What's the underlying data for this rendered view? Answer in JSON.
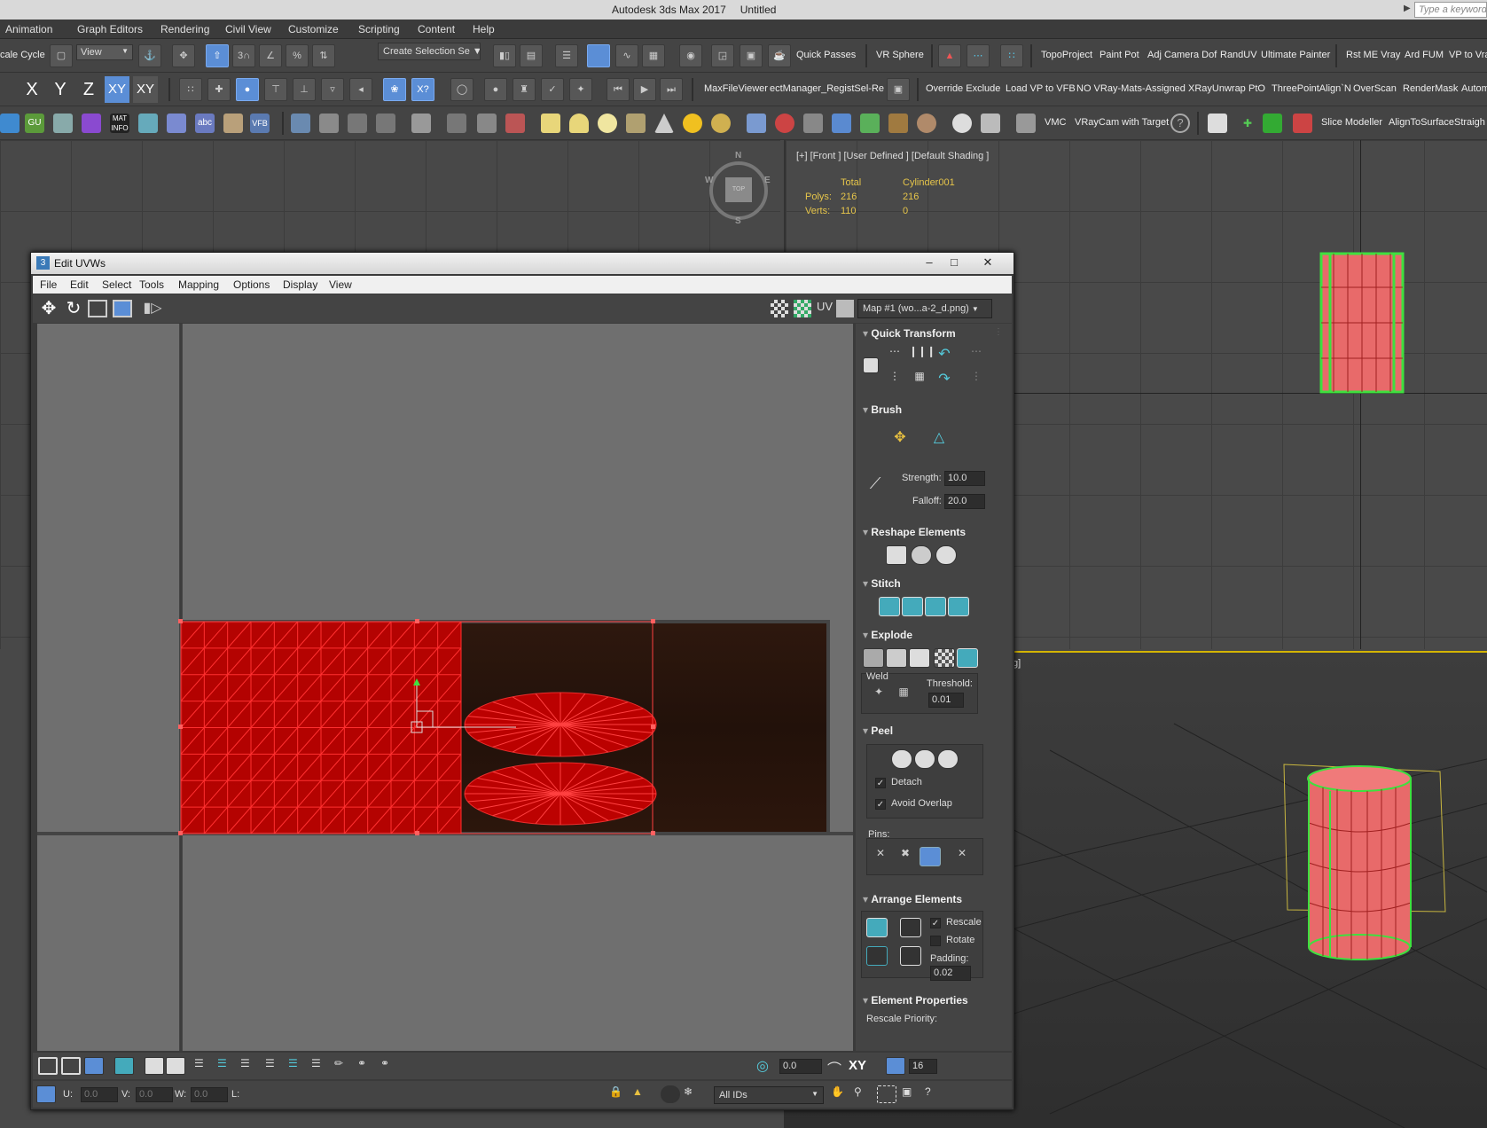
{
  "app": {
    "title": "Autodesk 3ds Max 2017",
    "document": "Untitled",
    "search_placeholder": "Type a keyword"
  },
  "menu": [
    "Animation",
    "Graph Editors",
    "Rendering",
    "Civil View",
    "Customize",
    "Scripting",
    "Content",
    "Help"
  ],
  "toolbar1": {
    "scale_cycle": "cale Cycle",
    "view_dropdown": "View",
    "selection_set": "Create Selection Se",
    "labels": [
      "Quick Passes",
      "VR Sphere",
      "TopoProject",
      "Paint Pot",
      "Adj Camera Dof",
      "RandUV",
      "Ultimate Painter",
      "Rst ME Vray",
      "Ard FUM",
      "VP to Vra"
    ]
  },
  "toolbar2": {
    "axes": [
      "X",
      "Y",
      "Z",
      "XY",
      "XY"
    ],
    "labels": [
      "MaxFileViewer",
      "ectManager_RegistSel-Re",
      "Override Exclude",
      "Load VP to VFB",
      "NO VRay-Mats-Assigned",
      "XRayUnwrap",
      "PtO",
      "ThreePointAlign`N",
      "OverScan",
      "RenderMask",
      "Autom"
    ]
  },
  "toolbar3": {
    "icon_texts": [
      "GU",
      "MAT INFO",
      "abc",
      "VFB"
    ],
    "labels": [
      "VMC",
      "VRayCam with Target",
      "Slice Modeller",
      "AlignToSurface",
      "Straigh"
    ]
  },
  "viewport": {
    "label": "[+] [Front ] [User Defined ] [Default Shading ]",
    "stats_header_total": "Total",
    "stats_header_object": "Cylinder001",
    "polys_label": "Polys:",
    "polys_total": "216",
    "polys_object": "216",
    "verts_label": "Verts:",
    "verts_total": "110",
    "verts_object": "0",
    "viewcube": {
      "n": "N",
      "s": "S",
      "e": "E",
      "w": "W",
      "face": "TOP"
    },
    "partial_label": "g]"
  },
  "uvw_window": {
    "title": "Edit UVWs",
    "menu": [
      "File",
      "Edit",
      "Select",
      "Tools",
      "Mapping",
      "Options",
      "Display",
      "View"
    ],
    "uv_label": "UV",
    "map_dropdown": "Map #1 (wo...a-2_d.png)",
    "rollouts": {
      "quick_transform": "Quick Transform",
      "brush": "Brush",
      "strength_label": "Strength:",
      "strength_value": "10.0",
      "falloff_label": "Falloff:",
      "falloff_value": "20.0",
      "reshape": "Reshape Elements",
      "stitch": "Stitch",
      "explode": "Explode",
      "weld_label": "Weld",
      "threshold_label": "Threshold:",
      "threshold_value": "0.01",
      "peel": "Peel",
      "detach_label": "Detach",
      "detach_checked": true,
      "avoid_overlap_label": "Avoid Overlap",
      "avoid_overlap_checked": true,
      "pins_label": "Pins:",
      "arrange": "Arrange Elements",
      "rescale_label": "Rescale",
      "rescale_checked": true,
      "rotate_label": "Rotate",
      "rotate_checked": false,
      "padding_label": "Padding:",
      "padding_value": "0.02",
      "element_props": "Element Properties",
      "rescale_priority_label": "Rescale Priority:"
    },
    "bottom": {
      "rotation_value": "0.0",
      "xy_label": "XY",
      "grid_value": "16",
      "u_label": "U:",
      "u_value": "0.0",
      "v_label": "V:",
      "v_value": "0.0",
      "w_label": "W:",
      "w_value": "0.0",
      "l_label": "L:",
      "ids_dropdown": "All IDs"
    }
  },
  "colors": {
    "accent": "#5b8ed6",
    "uv_red": "#d40000",
    "wood_dark": "#2a150d",
    "selection_green": "#3fe03f",
    "stats_yellow": "#e6c54a"
  }
}
